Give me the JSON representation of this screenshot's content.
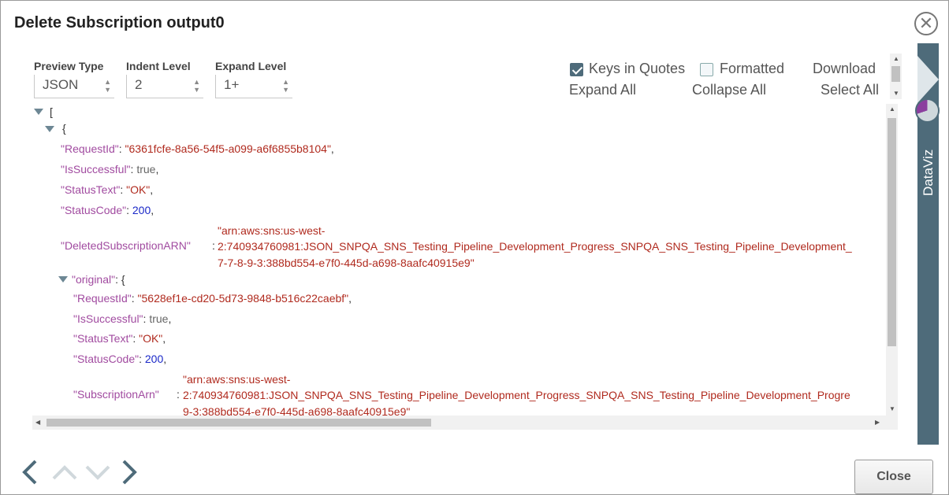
{
  "dialog": {
    "title": "Delete Subscription output0",
    "close_label": "Close"
  },
  "controls": {
    "preview_type": {
      "label": "Preview Type",
      "value": "JSON"
    },
    "indent_level": {
      "label": "Indent Level",
      "value": "2"
    },
    "expand_level": {
      "label": "Expand Level",
      "value": "1+"
    }
  },
  "options": {
    "keys_in_quotes": {
      "label": "Keys in Quotes",
      "checked": true
    },
    "formatted": {
      "label": "Formatted",
      "checked": false
    },
    "download": "Download",
    "expand_all": "Expand All",
    "collapse_all": "Collapse All",
    "select_all": "Select All"
  },
  "sidebar": {
    "label": "DataViz",
    "accent": "#4e6b7a"
  },
  "json": {
    "open_bracket": "[",
    "open_brace": "{",
    "request_id_key": "\"RequestId\"",
    "request_id_val": "\"6361fcfe-8a56-54f5-a099-a6f6855b8104\"",
    "is_successful_key": "\"IsSuccessful\"",
    "is_successful_val": "true",
    "status_text_key": "\"StatusText\"",
    "status_text_val": "\"OK\"",
    "status_code_key": "\"StatusCode\"",
    "status_code_val": "200",
    "deleted_arn_key": "\"DeletedSubscriptionARN\"",
    "deleted_arn_val_1": "\"arn:aws:sns:us-west-",
    "deleted_arn_val_2": "2:740934760981:JSON_SNPQA_SNS_Testing_Pipeline_Development_Progress_SNPQA_SNS_Testing_Pipeline_Development_",
    "deleted_arn_val_3": "7-7-8-9-3:388bd554-e7f0-445d-a698-8aafc40915e9\"",
    "original_key": "\"original\"",
    "orig_request_id_key": "\"RequestId\"",
    "orig_request_id_val": "\"5628ef1e-cd20-5d73-9848-b516c22caebf\"",
    "orig_is_successful_key": "\"IsSuccessful\"",
    "orig_is_successful_val": "true",
    "orig_status_text_key": "\"StatusText\"",
    "orig_status_text_val": "\"OK\"",
    "orig_status_code_key": "\"StatusCode\"",
    "orig_status_code_val": "200",
    "orig_sub_arn_key": "\"SubscriptionArn\"",
    "orig_sub_arn_val_1": "\"arn:aws:sns:us-west-",
    "orig_sub_arn_val_2": "2:740934760981:JSON_SNPQA_SNS_Testing_Pipeline_Development_Progress_SNPQA_SNS_Testing_Pipeline_Development_Progre",
    "orig_sub_arn_val_3": "9-3:388bd554-e7f0-445d-a698-8aafc40915e9\""
  },
  "icons": {
    "close": "close-icon",
    "prev": "chevron-left-icon",
    "up": "chevron-up-icon",
    "down": "chevron-down-icon",
    "next": "chevron-right-icon"
  }
}
